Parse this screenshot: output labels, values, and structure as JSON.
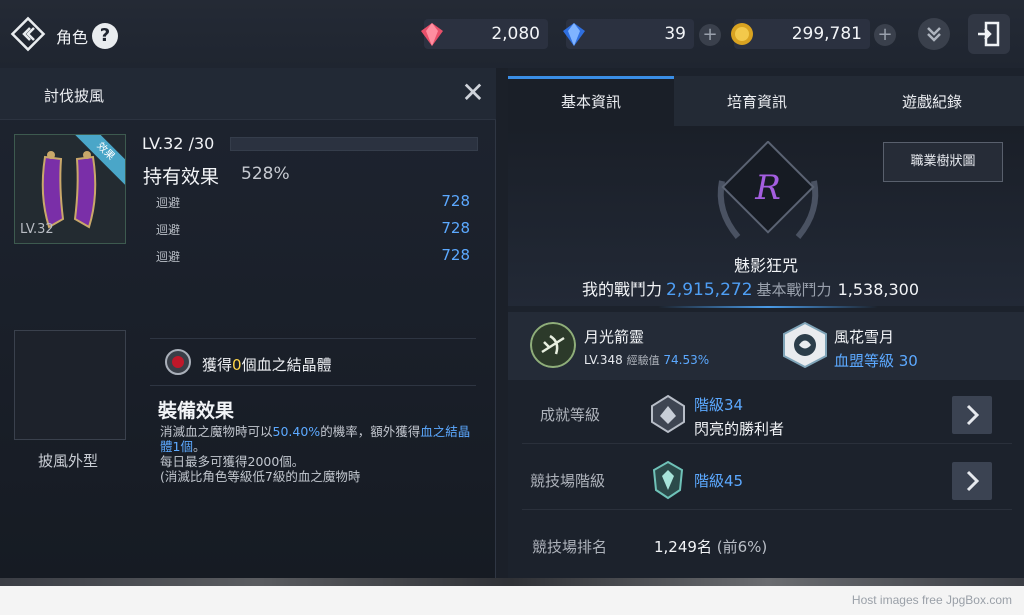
{
  "header": {
    "title": "角色",
    "help_label": "?",
    "currencies": [
      {
        "name": "ruby",
        "value": "2,080"
      },
      {
        "name": "sapphire",
        "value": "39"
      },
      {
        "name": "gold",
        "value": "299,781"
      }
    ],
    "plus": "+"
  },
  "left_panel": {
    "title": "討伐披風",
    "close": "✕",
    "item_badge": "效果",
    "item_level": "LV.32",
    "level_label": "LV.32 /30",
    "effect_label": "持有效果",
    "effect_pct": "528%",
    "stats": [
      {
        "name": "迴避",
        "value": "728"
      },
      {
        "name": "迴避",
        "value": "728"
      },
      {
        "name": "迴避",
        "value": "728"
      }
    ],
    "cloak_appearance_label": "披風外型",
    "crystal": {
      "pre": "獲得",
      "count": "0",
      "post": "個血之結晶體"
    },
    "equip_title": "裝備效果",
    "equip_desc": {
      "part1": "消滅血之魔物時可以",
      "pct": "50.40%",
      "part2": "的機率，額外獲得",
      "reward": "血之結晶體1個",
      "part3": "。",
      "line2": "每日最多可獲得2000個。",
      "line3": "(消滅比角色等級低7級的血之魔物時"
    }
  },
  "right_panel": {
    "tabs": [
      "基本資訊",
      "培育資訊",
      "遊戲紀錄"
    ],
    "active_tab": 0,
    "tree_button": "職業樹狀圖",
    "emblem_letter": "R",
    "char_name": "魅影狂咒",
    "my_power_label": "我的戰鬥力",
    "my_power": "2,915,272",
    "base_power_label": "基本戰鬥力",
    "base_power": "1,538,300",
    "guardian": {
      "name": "月光箭靈",
      "level": "LV.348",
      "exp_label": "經驗值",
      "exp": "74.53%"
    },
    "clan": {
      "name": "風花雪月",
      "level": "血盟等級 30"
    },
    "achievement": {
      "label": "成就等級",
      "tier": "階級34",
      "title": "閃亮的勝利者"
    },
    "arena": {
      "label": "競技場階級",
      "tier": "階級45"
    },
    "arena_rank": {
      "label": "競技場排名",
      "value": "1,249名",
      "pct": "(前6%)"
    }
  },
  "footer": {
    "text": "Host images free JpgBox.com"
  }
}
